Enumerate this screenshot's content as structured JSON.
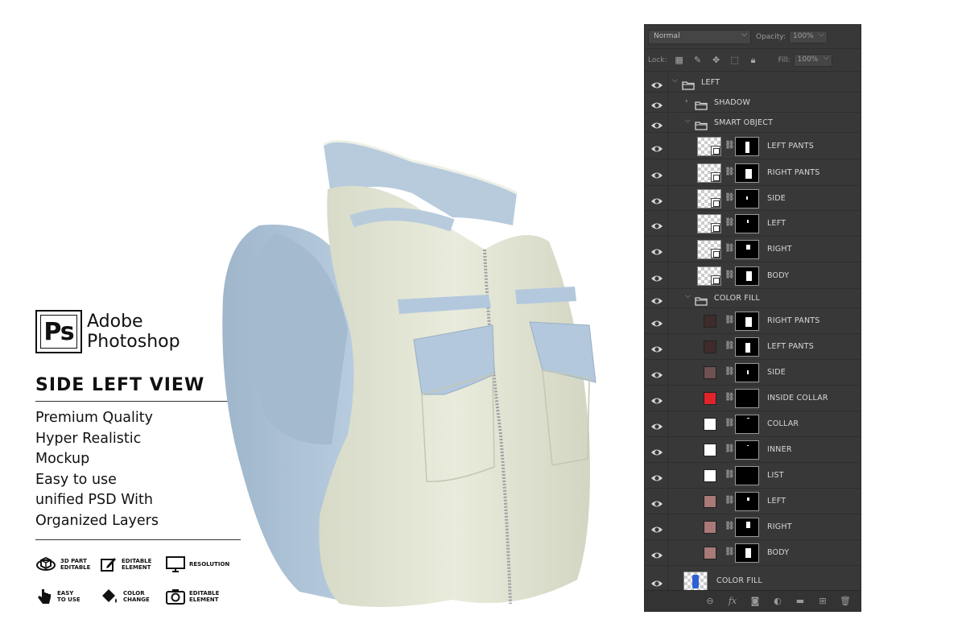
{
  "promo": {
    "brand_logo_text": "Ps",
    "brand_line1": "Adobe",
    "brand_line2": "Photoshop",
    "view_title": "SIDE LEFT VIEW",
    "features": [
      "Premium Quality",
      "Hyper Realistic",
      "Mockup",
      "Easy to use",
      "unified PSD With",
      "Organized Layers"
    ],
    "badges": [
      {
        "icon": "cube-3d-icon",
        "label": "3D PART\nEDITABLE"
      },
      {
        "icon": "edit-icon",
        "label": "EDITABLE\nELEMENT"
      },
      {
        "icon": "monitor-icon",
        "label": "RESOLUTION"
      },
      {
        "icon": "pointer-hand-icon",
        "label": "EASY\nTO USE"
      },
      {
        "icon": "paint-bucket-icon",
        "label": "COLOR\nCHANGE"
      },
      {
        "icon": "camera-icon",
        "label": "EDITABLE\nELEMENT"
      }
    ]
  },
  "panel": {
    "blend_mode": "Normal",
    "opacity_label": "Opacity:",
    "opacity_value": "100%",
    "lock_label": "Lock:",
    "fill_label": "Fill:",
    "fill_value": "100%",
    "layers": [
      {
        "name": "LEFT",
        "kind": "group",
        "open": true
      },
      {
        "name": "SHADOW",
        "kind": "group",
        "open": false
      },
      {
        "name": "SMART OBJECT",
        "kind": "group",
        "open": true
      },
      {
        "name": "LEFT PANTS",
        "kind": "smart"
      },
      {
        "name": "RIGHT PANTS",
        "kind": "smart"
      },
      {
        "name": "SIDE",
        "kind": "smart"
      },
      {
        "name": "LEFT",
        "kind": "smart"
      },
      {
        "name": "RIGHT",
        "kind": "smart"
      },
      {
        "name": "BODY",
        "kind": "smart"
      },
      {
        "name": "COLOR FILL",
        "kind": "group",
        "open": true
      },
      {
        "name": "RIGHT PANTS",
        "kind": "fill",
        "color": "#3f2b2c"
      },
      {
        "name": "LEFT PANTS",
        "kind": "fill",
        "color": "#3f2b2c"
      },
      {
        "name": "SIDE",
        "kind": "fill",
        "color": "#6e5153"
      },
      {
        "name": "INSIDE COLLAR",
        "kind": "fill",
        "color": "#e0242a"
      },
      {
        "name": "COLLAR",
        "kind": "fill",
        "color": "#ffffff"
      },
      {
        "name": "INNER",
        "kind": "fill",
        "color": "#ffffff"
      },
      {
        "name": "LIST",
        "kind": "fill",
        "color": "#ffffff"
      },
      {
        "name": "LEFT",
        "kind": "fill",
        "color": "#a87a78"
      },
      {
        "name": "RIGHT",
        "kind": "fill",
        "color": "#a87a78"
      },
      {
        "name": "BODY",
        "kind": "fill",
        "color": "#a87a78"
      },
      {
        "name": "COLOR FILL",
        "kind": "base"
      }
    ],
    "footer_icons": [
      "link-layers-icon",
      "fx-icon",
      "add-mask-icon",
      "adjustment-layer-icon",
      "new-group-icon",
      "new-layer-icon",
      "trash-icon"
    ]
  },
  "colors": {
    "vest_body": "#e4e6d6",
    "vest_accent": "#b3c8dc",
    "panel_bg": "#383838"
  }
}
